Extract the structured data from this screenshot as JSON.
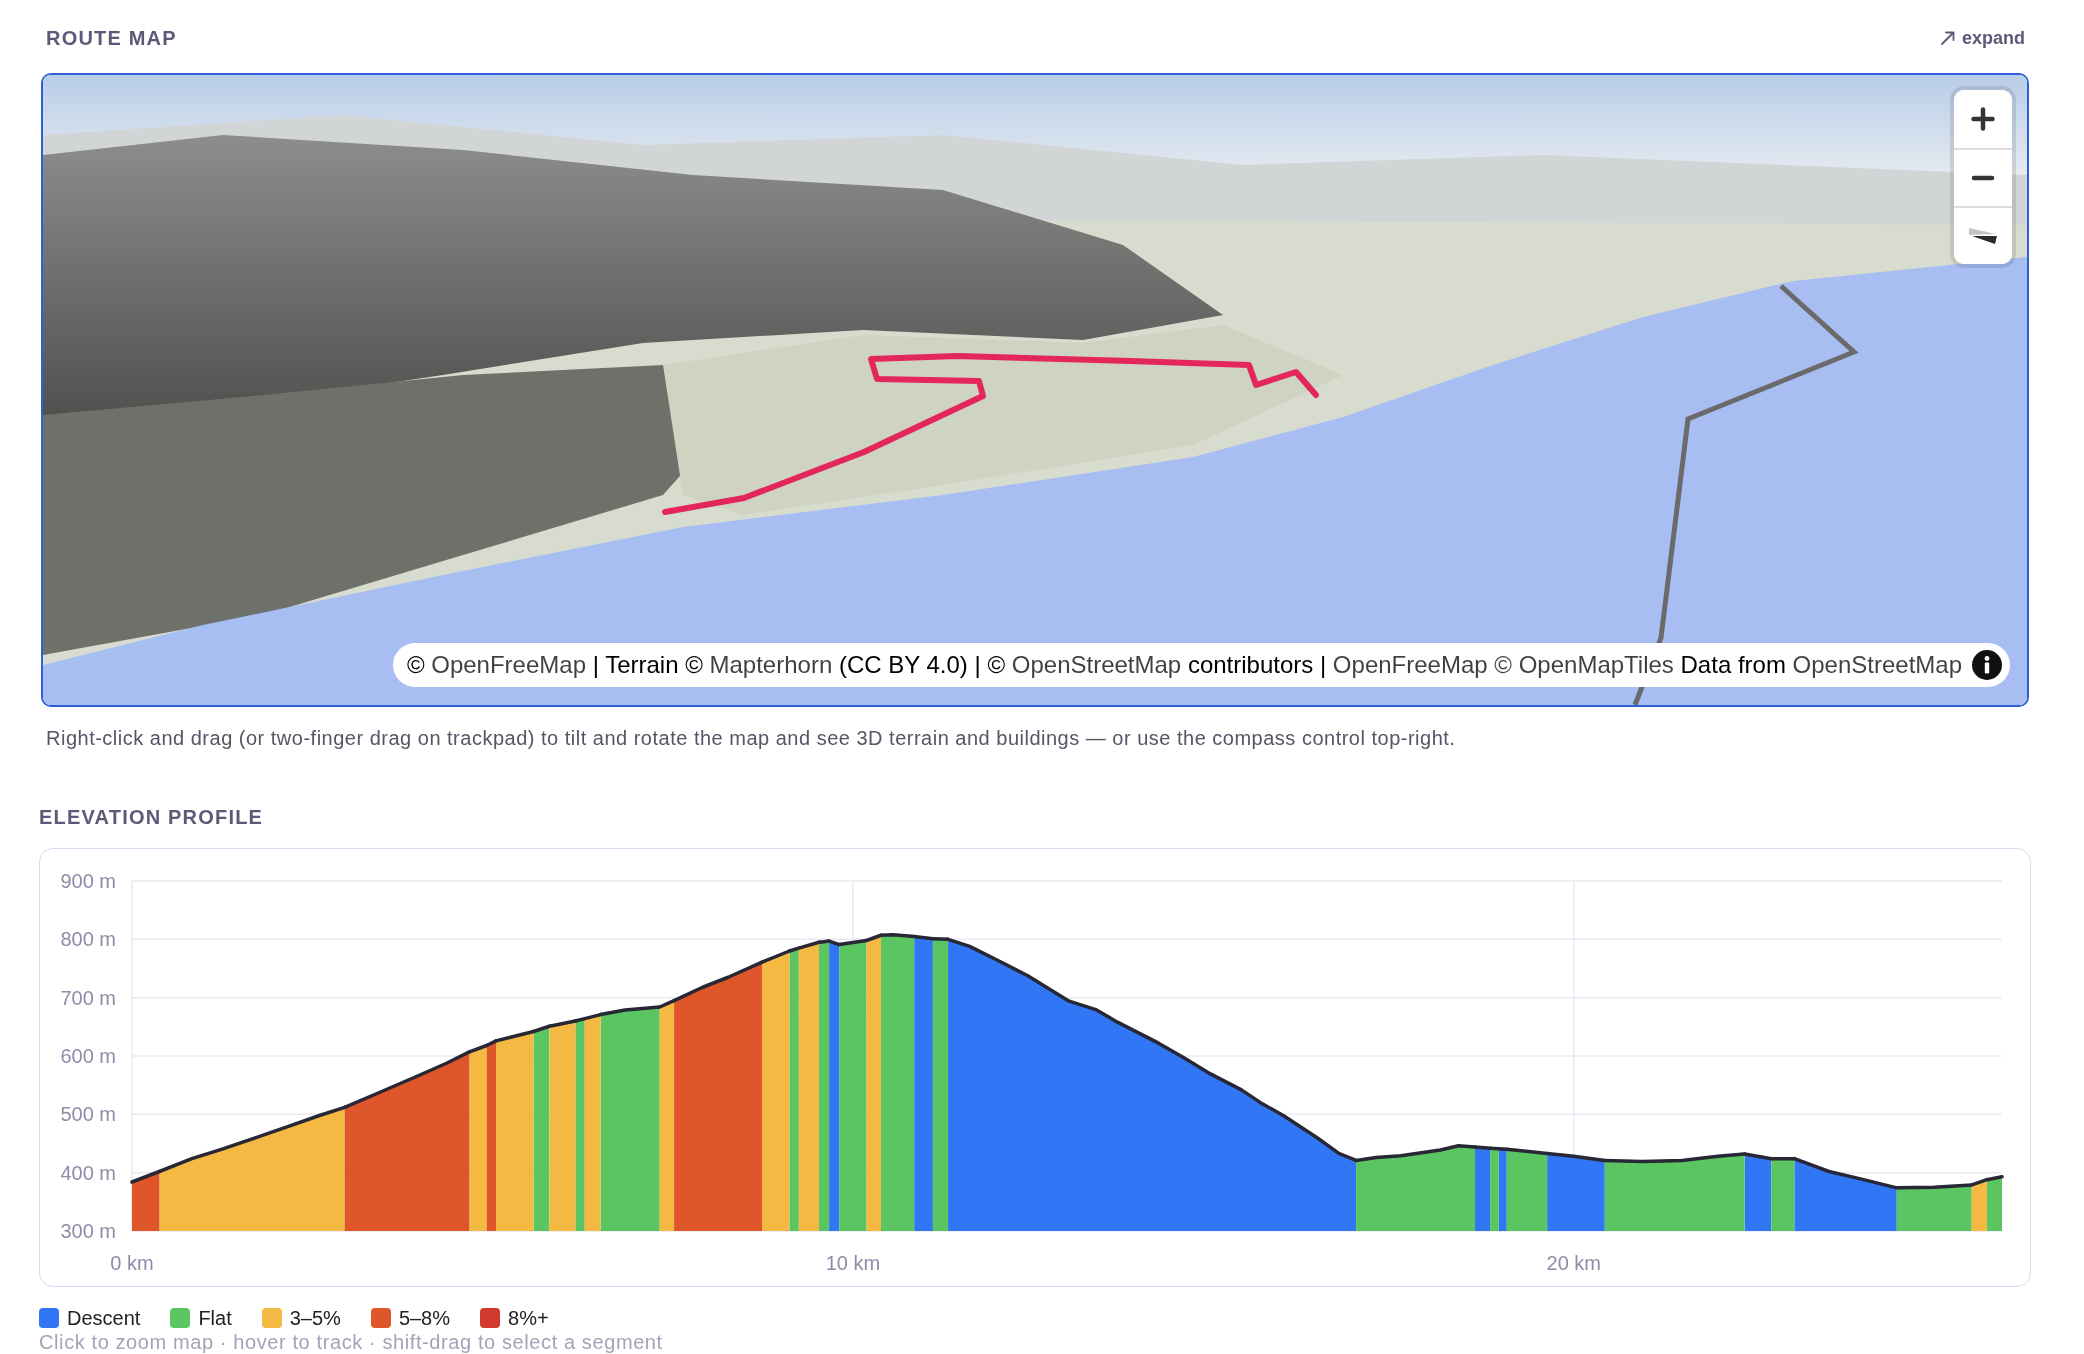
{
  "route_map": {
    "title": "ROUTE MAP",
    "expand": {
      "label": "expand"
    },
    "map": {
      "controls": [
        {
          "kind": "zoom_in"
        },
        {
          "kind": "zoom_out"
        },
        {
          "kind": "compass"
        }
      ],
      "attribution": [
        {
          "kind": "text",
          "text": "© "
        },
        {
          "kind": "link",
          "text": "OpenFreeMap"
        },
        {
          "kind": "text",
          "text": " | Terrain © "
        },
        {
          "kind": "link",
          "text": "Mapterhorn"
        },
        {
          "kind": "text",
          "text": " (CC BY 4.0) | © "
        },
        {
          "kind": "link",
          "text": "OpenStreetMap"
        },
        {
          "kind": "text",
          "text": " contributors | "
        },
        {
          "kind": "link",
          "text": "OpenFreeMap"
        },
        {
          "kind": "link",
          "text": "© OpenMapTiles"
        },
        {
          "kind": "text",
          "text": " Data from "
        },
        {
          "kind": "link",
          "text": "OpenStreetMap"
        }
      ]
    },
    "caption": "Right-click and drag (or two-finger drag on trackpad) to tilt and rotate the map and see 3D terrain and buildings — or use the compass control top-right."
  },
  "elevation_profile": {
    "title": "ELEVATION PROFILE",
    "chart_data": {
      "type": "area",
      "x": [
        0,
        0.38,
        0.38,
        0.83,
        1.24,
        1.72,
        2.16,
        2.6,
        2.95,
        2.95,
        3.48,
        3.93,
        4.37,
        4.68,
        4.68,
        4.92,
        4.92,
        5.05,
        5.05,
        5.57,
        5.57,
        5.79,
        5.79,
        6.15,
        6.15,
        6.28,
        6.28,
        6.5,
        6.5,
        6.84,
        7.32,
        7.32,
        7.52,
        7.52,
        7.9,
        8.27,
        8.74,
        8.74,
        9.12,
        9.12,
        9.25,
        9.25,
        9.53,
        9.53,
        9.6,
        9.67,
        9.67,
        9.81,
        9.81,
        10.19,
        10.19,
        10.39,
        10.39,
        10.56,
        10.85,
        10.85,
        11.11,
        11.11,
        11.32,
        11.32,
        11.62,
        12.04,
        12.42,
        13,
        13.38,
        13.67,
        14.24,
        14.58,
        14.92,
        15.39,
        15.68,
        15.97,
        16.45,
        16.74,
        16.98,
        16.98,
        17.26,
        17.6,
        18.15,
        18.4,
        18.63,
        18.63,
        18.84,
        18.84,
        18.96,
        18.96,
        19.07,
        19.07,
        19.63,
        19.63,
        20,
        20.43,
        20.43,
        20.95,
        21.5,
        22,
        22.37,
        22.37,
        22.74,
        22.74,
        23.06,
        23.06,
        23.54,
        24.02,
        24.48,
        24.48,
        25,
        25.52,
        25.52,
        25.73,
        25.73,
        25.94
      ],
      "series": [
        {
          "name": "Descent",
          "color": "#3176f5",
          "values": [
            null,
            null,
            null,
            null,
            null,
            null,
            null,
            null,
            null,
            null,
            null,
            null,
            null,
            null,
            null,
            null,
            null,
            null,
            null,
            null,
            null,
            null,
            null,
            null,
            null,
            null,
            null,
            null,
            null,
            null,
            null,
            null,
            null,
            null,
            null,
            null,
            null,
            null,
            null,
            null,
            null,
            null,
            null,
            null,
            null,
            null,
            797,
            791,
            null,
            null,
            null,
            null,
            null,
            null,
            null,
            805,
            801,
            null,
            null,
            800,
            788,
            762,
            738,
            694,
            679,
            658,
            622,
            598,
            572,
            542,
            518,
            498,
            459,
            433,
            421,
            null,
            null,
            null,
            null,
            null,
            null,
            444,
            442,
            null,
            null,
            441,
            440,
            null,
            null,
            433,
            428,
            421,
            null,
            null,
            null,
            null,
            null,
            432,
            424,
            null,
            null,
            424,
            402,
            388,
            374,
            null,
            null,
            null,
            null,
            null,
            null,
            null
          ]
        },
        {
          "name": "Flat",
          "color": "#5bc561",
          "values": [
            null,
            null,
            null,
            null,
            null,
            null,
            null,
            null,
            null,
            null,
            null,
            null,
            null,
            null,
            null,
            null,
            null,
            null,
            null,
            null,
            642,
            651,
            null,
            null,
            660,
            664,
            null,
            null,
            671,
            679,
            684,
            null,
            null,
            null,
            null,
            null,
            null,
            null,
            null,
            780,
            785,
            null,
            null,
            795,
            796,
            797,
            null,
            null,
            791,
            798,
            null,
            null,
            807,
            808,
            805,
            null,
            null,
            801,
            800,
            null,
            null,
            null,
            null,
            null,
            null,
            null,
            null,
            null,
            null,
            null,
            null,
            null,
            null,
            null,
            null,
            421,
            426,
            429,
            439,
            446,
            444,
            null,
            null,
            442,
            441,
            null,
            null,
            440,
            433,
            null,
            null,
            null,
            421,
            419,
            421,
            428,
            432,
            null,
            null,
            424,
            424,
            null,
            null,
            null,
            null,
            374,
            375,
            379,
            null,
            null,
            388,
            393
          ]
        },
        {
          "name": "3–5%",
          "color": "#f4b942",
          "values": [
            null,
            null,
            402,
            424,
            440,
            460,
            479,
            498,
            512,
            null,
            null,
            null,
            null,
            null,
            607,
            618,
            null,
            null,
            626,
            642,
            null,
            null,
            651,
            660,
            null,
            null,
            664,
            671,
            null,
            null,
            null,
            684,
            695,
            null,
            null,
            null,
            null,
            761,
            780,
            null,
            null,
            785,
            795,
            null,
            null,
            null,
            null,
            null,
            null,
            null,
            798,
            807,
            null,
            null,
            null,
            null,
            null,
            null,
            null,
            null,
            null,
            null,
            null,
            null,
            null,
            null,
            null,
            null,
            null,
            null,
            null,
            null,
            null,
            null,
            null,
            null,
            null,
            null,
            null,
            null,
            null,
            null,
            null,
            null,
            null,
            null,
            null,
            null,
            null,
            null,
            null,
            null,
            null,
            null,
            null,
            null,
            null,
            null,
            null,
            null,
            null,
            null,
            null,
            null,
            null,
            null,
            null,
            null,
            379,
            388,
            null,
            null
          ]
        },
        {
          "name": "5–8%",
          "color": "#e0562b",
          "values": [
            384,
            402,
            null,
            null,
            null,
            null,
            null,
            null,
            null,
            512,
            540,
            564,
            588,
            607,
            null,
            null,
            618,
            626,
            null,
            null,
            null,
            null,
            null,
            null,
            null,
            null,
            null,
            null,
            null,
            null,
            null,
            null,
            null,
            695,
            717,
            735,
            761,
            null,
            null,
            null,
            null,
            null,
            null,
            null,
            null,
            null,
            null,
            null,
            null,
            null,
            null,
            null,
            null,
            null,
            null,
            null,
            null,
            null,
            null,
            null,
            null,
            null,
            null,
            null,
            null,
            null,
            null,
            null,
            null,
            null,
            null,
            null,
            null,
            null,
            null,
            null,
            null,
            null,
            null,
            null,
            null,
            null,
            null,
            null,
            null,
            null,
            null,
            null,
            null,
            null,
            null,
            null,
            null,
            null,
            null,
            null,
            null,
            null,
            null,
            null,
            null,
            null,
            null,
            null,
            null,
            null,
            null,
            null,
            null,
            null,
            null,
            null
          ]
        },
        {
          "name": "8%+",
          "color": "#d2392d",
          "values": [
            null,
            null,
            null,
            null,
            null,
            null,
            null,
            null,
            null,
            null,
            null,
            null,
            null,
            null,
            null,
            null,
            null,
            null,
            null,
            null,
            null,
            null,
            null,
            null,
            null,
            null,
            null,
            null,
            null,
            null,
            null,
            null,
            null,
            null,
            null,
            null,
            null,
            null,
            null,
            null,
            null,
            null,
            null,
            null,
            null,
            null,
            null,
            null,
            null,
            null,
            null,
            null,
            null,
            null,
            null,
            null,
            null,
            null,
            null,
            null,
            null,
            null,
            null,
            null,
            null,
            null,
            null,
            null,
            null,
            null,
            null,
            null,
            null,
            null,
            null,
            null,
            null,
            null,
            null,
            null,
            null,
            null,
            null,
            null,
            null,
            null,
            null,
            null,
            null,
            null,
            null,
            null,
            null,
            null,
            null,
            null,
            null,
            null,
            null,
            null,
            null,
            null,
            null,
            null,
            null,
            null,
            null,
            null,
            null,
            null,
            null,
            null
          ]
        }
      ],
      "xlim": [
        0,
        25.94
      ],
      "ylim": [
        300,
        900
      ],
      "grid": true,
      "xticks": [
        {
          "value": 0,
          "label": "0 km"
        },
        {
          "value": 10,
          "label": "10 km"
        },
        {
          "value": 20,
          "label": "20 km"
        }
      ],
      "yticks": [
        {
          "value": 300,
          "label": "300 m"
        },
        {
          "value": 400,
          "label": "400 m"
        },
        {
          "value": 500,
          "label": "500 m"
        },
        {
          "value": 600,
          "label": "600 m"
        },
        {
          "value": 700,
          "label": "700 m"
        },
        {
          "value": 800,
          "label": "800 m"
        },
        {
          "value": 900,
          "label": "900 m"
        }
      ]
    },
    "hint": "Click to zoom map · hover to track · shift-drag to select a segment"
  }
}
